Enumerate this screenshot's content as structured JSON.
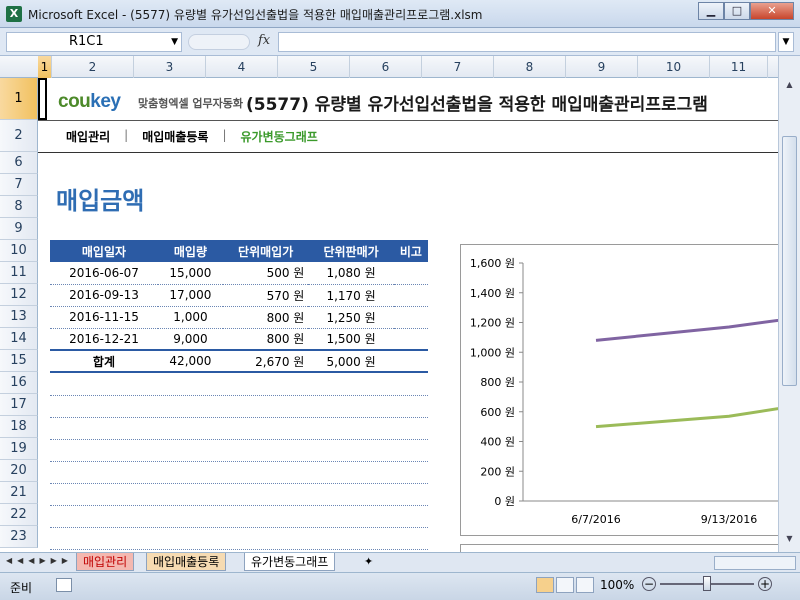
{
  "window": {
    "title": "Microsoft Excel - (5577) 유량별 유가선입선출법을 적용한 매입매출관리프로그램.xlsm",
    "app_icon": "X",
    "min": "▁",
    "max": "□",
    "close": "✕"
  },
  "formula_bar": {
    "namebox": "R1C1",
    "fx": "fx",
    "value": ""
  },
  "columns": [
    "1",
    "2",
    "3",
    "4",
    "5",
    "6",
    "7",
    "8",
    "9",
    "10",
    "11"
  ],
  "rows": [
    "1",
    "2",
    "6",
    "7",
    "8",
    "9",
    "10",
    "11",
    "12",
    "13",
    "14",
    "15",
    "16",
    "17",
    "18",
    "19",
    "20",
    "21",
    "22",
    "23"
  ],
  "header": {
    "logo_a": "cou",
    "logo_b": "key",
    "logo_sub": "맞춤형엑셀 업무자동화",
    "doc_title": "(5577) 유량별 유가선입선출법을 적용한 매입매출관리프로그램"
  },
  "nav": {
    "item1": "매입관리",
    "item2": "매입매출등록",
    "item3": "유가변동그래프",
    "sep": "|"
  },
  "section_title": "매입금액",
  "table": {
    "headers": [
      "매입일자",
      "매입량",
      "단위매입가",
      "단위판매가",
      "비고"
    ],
    "rows": [
      [
        "2016-06-07",
        "15,000",
        "500 원",
        "1,080 원",
        ""
      ],
      [
        "2016-09-13",
        "17,000",
        "570 원",
        "1,170 원",
        ""
      ],
      [
        "2016-11-15",
        "1,000",
        "800 원",
        "1,250 원",
        ""
      ],
      [
        "2016-12-21",
        "9,000",
        "800 원",
        "1,500 원",
        ""
      ]
    ],
    "total": [
      "합계",
      "42,000",
      "2,670 원",
      "5,000 원",
      ""
    ]
  },
  "chart_data": {
    "type": "line",
    "x": [
      "6/7/2016",
      "9/13/2016"
    ],
    "ytick_labels": [
      "0 원",
      "200 원",
      "400 원",
      "600 원",
      "800 원",
      "1,000 원",
      "1,200 원",
      "1,400 원",
      "1,600 원"
    ],
    "ylim": [
      0,
      1600
    ],
    "series": [
      {
        "values": [
          1080,
          1170
        ],
        "color": "#8064a2"
      },
      {
        "values": [
          500,
          570
        ],
        "color": "#9bbb59"
      }
    ]
  },
  "tabs": [
    "매입관리",
    "매입매출등록",
    "유가변동그래프"
  ],
  "status": {
    "ready": "준비",
    "zoom": "100%",
    "minus": "−",
    "plus": "+"
  }
}
